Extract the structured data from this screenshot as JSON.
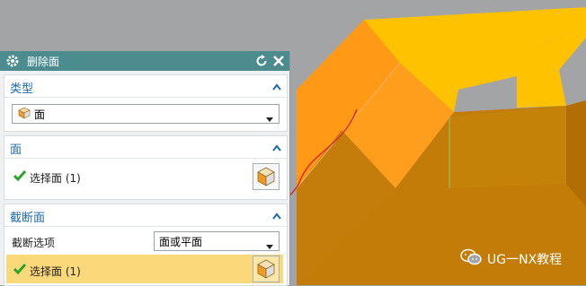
{
  "dialog": {
    "title": "删除面",
    "icons": {
      "settings": "gear-icon",
      "reset": "reset-icon",
      "close": "close-icon"
    }
  },
  "section_type": {
    "header": "类型",
    "selected": "面"
  },
  "section_face": {
    "header": "面",
    "select_label": "选择面 (1)"
  },
  "section_cut": {
    "header": "截断面",
    "option_label": "截断选项",
    "option_value": "面或平面",
    "select_label": "选择面 (1)"
  },
  "watermark": {
    "text": "UG一NX教程"
  },
  "colors": {
    "title_bar": "#4d8c8e",
    "section_header": "#1f6aa7",
    "highlight_row": "#fbd97a",
    "model_top": "#ffc200",
    "model_front": "#c97f0a",
    "model_face_selected": "#ff9c1a"
  }
}
